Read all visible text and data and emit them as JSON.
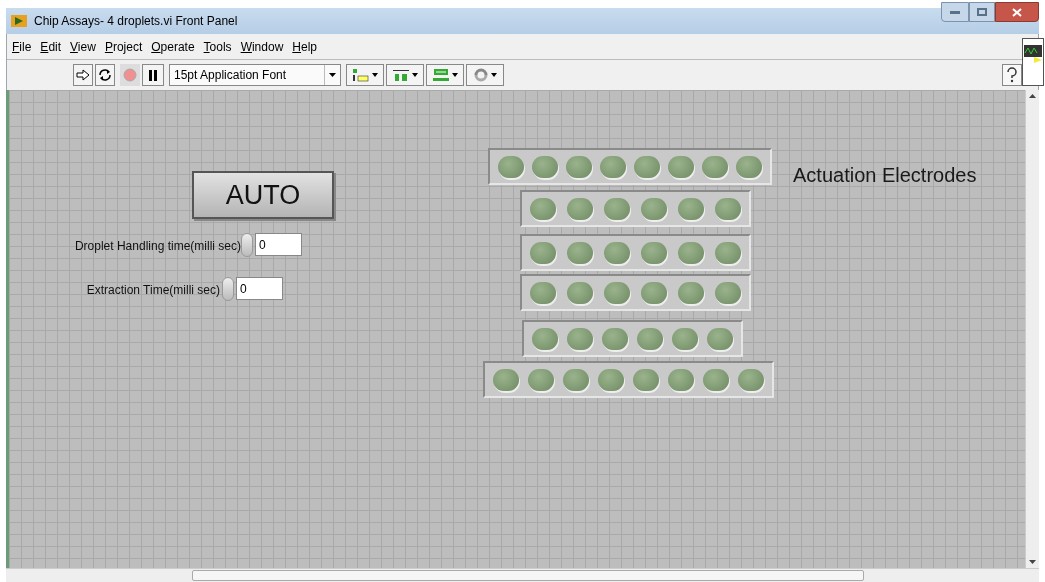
{
  "window": {
    "title": "Chip Assays- 4 droplets.vi Front Panel"
  },
  "menu": [
    "File",
    "Edit",
    "View",
    "Project",
    "Operate",
    "Tools",
    "Window",
    "Help"
  ],
  "toolbar": {
    "font_selector": "15pt Application Font"
  },
  "panel": {
    "auto_button": {
      "label": "AUTO"
    },
    "controls": [
      {
        "label": "Droplet Handling time(milli sec)",
        "value": "0"
      },
      {
        "label": "Extraction Time(milli sec)",
        "value": "0"
      }
    ],
    "electrodes_label": "Actuation Electrodes",
    "electrode_rows": [
      {
        "leds": [
          {
            "on": false
          },
          {
            "on": false
          },
          {
            "on": false
          },
          {
            "on": false
          },
          {
            "on": false
          },
          {
            "on": false
          },
          {
            "on": false
          },
          {
            "on": false
          }
        ]
      },
      {
        "leds": [
          {
            "on": false
          },
          {
            "on": false
          },
          {
            "on": false
          },
          {
            "on": false
          },
          {
            "on": false
          },
          {
            "on": false
          }
        ]
      },
      {
        "leds": [
          {
            "on": false
          },
          {
            "on": false
          },
          {
            "on": false
          },
          {
            "on": false
          },
          {
            "on": false
          },
          {
            "on": false
          }
        ]
      },
      {
        "leds": [
          {
            "on": false
          },
          {
            "on": false
          },
          {
            "on": false
          },
          {
            "on": false
          },
          {
            "on": false
          },
          {
            "on": false
          }
        ]
      },
      {
        "leds": [
          {
            "on": false
          },
          {
            "on": false
          },
          {
            "on": false
          },
          {
            "on": false
          },
          {
            "on": false
          },
          {
            "on": false
          }
        ]
      },
      {
        "leds": [
          {
            "on": false
          },
          {
            "on": false
          },
          {
            "on": false
          },
          {
            "on": false
          },
          {
            "on": false
          },
          {
            "on": false
          },
          {
            "on": false
          },
          {
            "on": false
          }
        ]
      }
    ]
  }
}
